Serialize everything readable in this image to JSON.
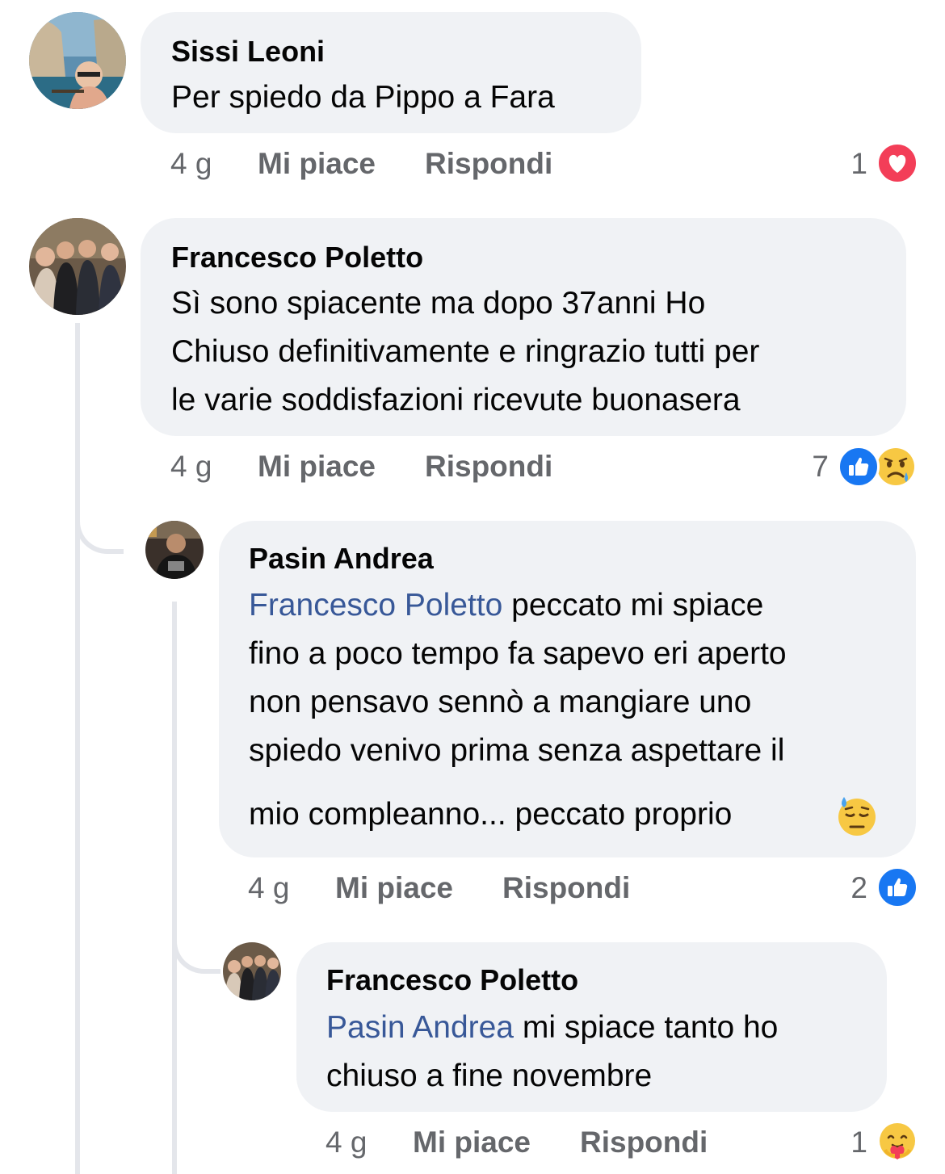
{
  "comments": [
    {
      "author": "Sissi Leoni",
      "text": "Per spiedo da Pippo a Fara",
      "time": "4 g",
      "like_label": "Mi piace",
      "reply_label": "Rispondi",
      "reaction_count": "1",
      "reactions": [
        "heart-icon"
      ]
    },
    {
      "author": "Francesco Poletto",
      "text_lines": [
        "Sì sono spiacente ma dopo 37anni Ho",
        "Chiuso definitivamente e ringrazio tutti per",
        "le varie soddisfazioni ricevute buonasera"
      ],
      "time": "4 g",
      "like_label": "Mi piace",
      "reply_label": "Rispondi",
      "reaction_count": "7",
      "reactions": [
        "like-icon",
        "sad-icon"
      ]
    },
    {
      "author": "Pasin Andrea",
      "mention": "Francesco Poletto",
      "text_first": " peccato mi spiace",
      "text_lines": [
        "fino a poco tempo fa sapevo eri aperto",
        "non pensavo sennò a mangiare uno",
        "spiedo venivo prima senza aspettare il",
        "mio compleanno... peccato proprio"
      ],
      "time": "4 g",
      "like_label": "Mi piace",
      "reply_label": "Rispondi",
      "reaction_count": "2",
      "reactions": [
        "like-icon"
      ]
    },
    {
      "author": "Francesco Poletto",
      "mention": "Pasin Andrea",
      "text_first": " mi spiace tanto ho",
      "text_lines": [
        "chiuso a fine novembre"
      ],
      "time": "4 g",
      "like_label": "Mi piace",
      "reply_label": "Rispondi",
      "reaction_count": "1",
      "reactions": [
        "care-icon"
      ]
    }
  ],
  "colors": {
    "bubble": "#f0f2f5",
    "meta_text": "#65676b",
    "mention": "#385898",
    "like_blue": "#1877f2",
    "heart_red": "#f33e58"
  }
}
